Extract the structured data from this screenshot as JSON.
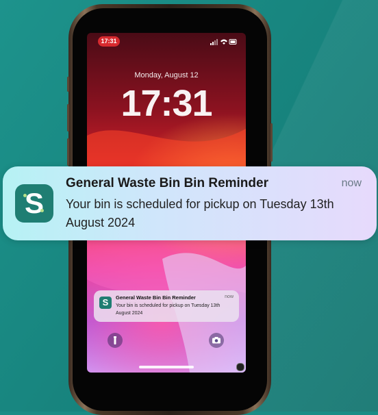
{
  "lockscreen": {
    "status_time": "17:31",
    "date": "Monday, August 12",
    "time": "17:31"
  },
  "notification": {
    "app_icon_letter": "S",
    "title": "General Waste Bin Bin Reminder",
    "time_label": "now",
    "body": "Your bin is scheduled for pickup on Tuesday 13th August 2024"
  },
  "lock_buttons": {
    "left_icon": "flashlight-icon",
    "right_icon": "camera-icon"
  },
  "colors": {
    "background": "#1a8c86",
    "app_icon": "#1f7e73",
    "status_pill": "#d72a2f"
  }
}
